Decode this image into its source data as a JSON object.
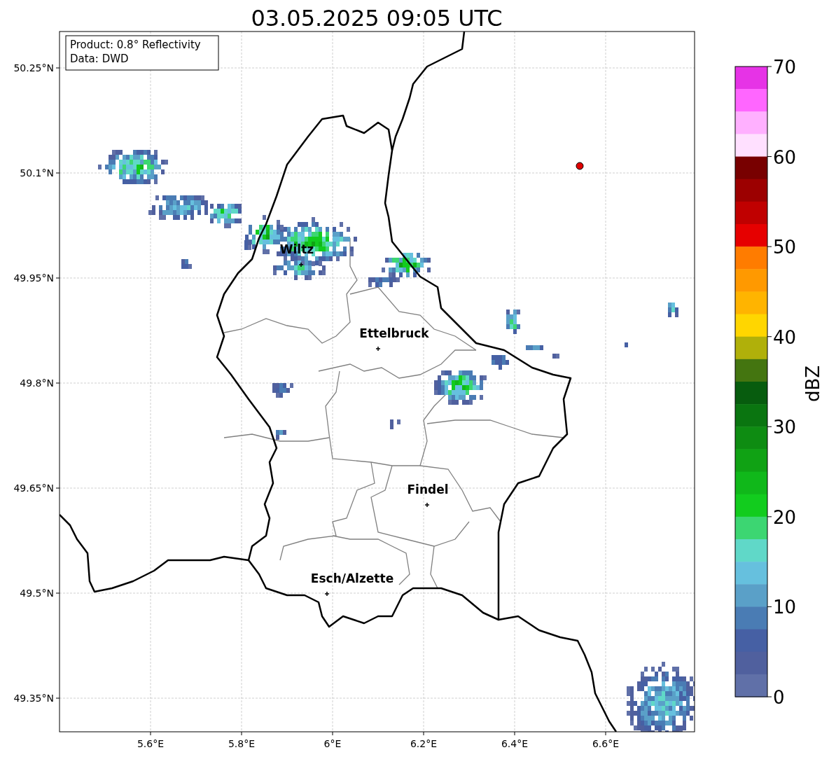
{
  "title": "03.05.2025 09:05 UTC",
  "info_box": [
    "Product: 0.8° Reflectivity",
    "Data: DWD"
  ],
  "cities": [
    {
      "name": "Wiltz"
    },
    {
      "name": "Ettelbruck"
    },
    {
      "name": "Findel"
    },
    {
      "name": "Esch/Alzette"
    }
  ],
  "lat_ticks": [
    "50.25°N",
    "50.1°N",
    "49.95°N",
    "49.8°N",
    "49.65°N",
    "49.5°N",
    "49.35°N"
  ],
  "lon_ticks": [
    "5.6°E",
    "5.8°E",
    "6°E",
    "6.2°E",
    "6.4°E",
    "6.6°E"
  ],
  "colorbar": {
    "label": "dBZ",
    "ticks": [
      "70",
      "60",
      "50",
      "40",
      "30",
      "20",
      "10",
      "0"
    ],
    "segments": [
      {
        "color": "#e633e6"
      },
      {
        "color": "#ff66ff"
      },
      {
        "color": "#ffb0ff"
      },
      {
        "color": "#ffe0ff"
      },
      {
        "color": "#780000"
      },
      {
        "color": "#9c0000"
      },
      {
        "color": "#c00000"
      },
      {
        "color": "#e60000"
      },
      {
        "color": "#ff7c00"
      },
      {
        "color": "#ff9900"
      },
      {
        "color": "#ffb400"
      },
      {
        "color": "#ffd600"
      },
      {
        "color": "#b0b00a"
      },
      {
        "color": "#447510"
      },
      {
        "color": "#075c0e"
      },
      {
        "color": "#0a7510"
      },
      {
        "color": "#0e8c12"
      },
      {
        "color": "#10a214"
      },
      {
        "color": "#10b81a"
      },
      {
        "color": "#12cc1e"
      },
      {
        "color": "#3cd672"
      },
      {
        "color": "#60d8c8"
      },
      {
        "color": "#66c0de"
      },
      {
        "color": "#5aa0c8"
      },
      {
        "color": "#4a7cb4"
      },
      {
        "color": "#4660a4"
      },
      {
        "color": "#50609e"
      },
      {
        "color": "#6070a8"
      }
    ]
  }
}
